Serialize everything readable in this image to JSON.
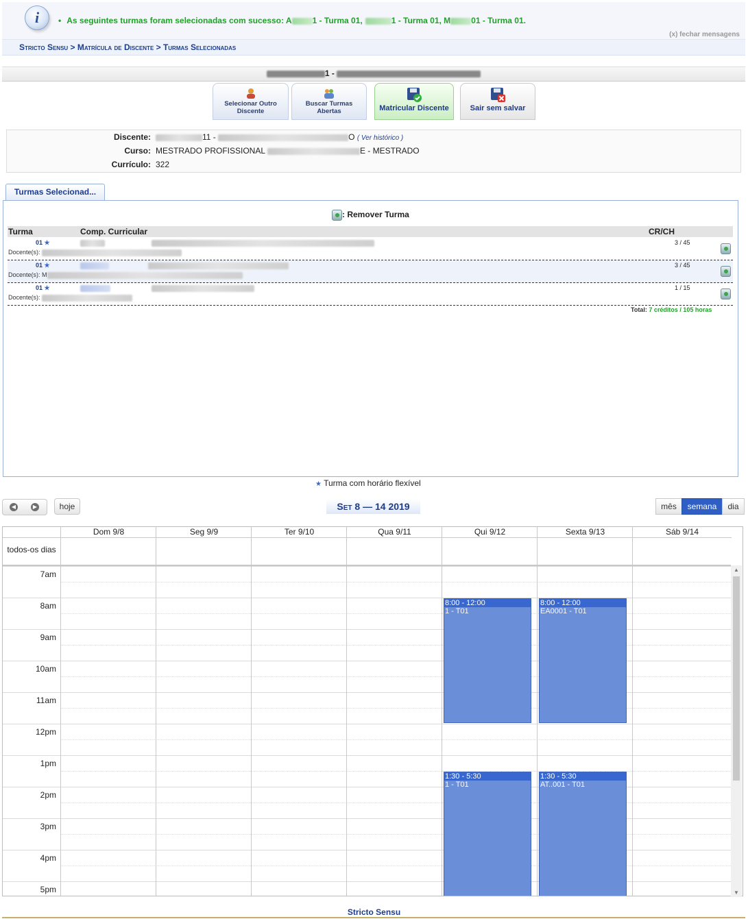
{
  "messages": {
    "success_prefix": "As seguintes turmas foram selecionadas com sucesso: A",
    "item1_suffix": "1 - Turma 01,",
    "item2_suffix": "1 - Turma 01, M",
    "item3_suffix": "01 - Turma 01.",
    "close_label": "(x) fechar mensagens"
  },
  "breadcrumb": "Stricto Sensu > Matrícula de Discente > Turmas Selecionadas",
  "student_header_suffix": "1 -",
  "actions": {
    "select_other": "Selecionar Outro Discente",
    "search_classes": "Buscar Turmas Abertas",
    "enroll": "Matricular Discente",
    "exit": "Sair sem salvar"
  },
  "info": {
    "discente_label": "Discente:",
    "discente_visible": "11 -",
    "discente_visible2": "O",
    "history_link": "( Ver histórico )",
    "curso_label": "Curso:",
    "curso_prefix": "MESTRADO PROFISSIONAL",
    "curso_suffix": "E - MESTRADO",
    "curriculo_label": "Currículo:",
    "curriculo_value": "322"
  },
  "tab_label": "Turmas Selecionad...",
  "remove_title": ": Remover Turma",
  "table": {
    "headers": [
      "Turma",
      "Comp. Curricular",
      "CR/CH"
    ],
    "rows": [
      {
        "turma": "01",
        "crch": "3 / 45",
        "doc_label": "Docente(s):"
      },
      {
        "turma": "01",
        "crch": "3 / 45",
        "doc_label": "Docente(s): M"
      },
      {
        "turma": "01",
        "crch": "1 / 15",
        "doc_label": "Docente(s):"
      }
    ],
    "total_label": "Total:",
    "total_value": "7 créditos / 105 horas"
  },
  "legend": "Turma com horário flexível",
  "calendar": {
    "today": "hoje",
    "title": "Set 8 — 14 2019",
    "views": [
      "mês",
      "semana",
      "dia"
    ],
    "allday_label": "todos-os dias",
    "days": [
      "Dom 9/8",
      "Seg 9/9",
      "Ter 9/10",
      "Qua 9/11",
      "Qui 9/12",
      "Sexta 9/13",
      "Sáb 9/14"
    ],
    "hours": [
      "7am",
      "8am",
      "9am",
      "10am",
      "11am",
      "12pm",
      "1pm",
      "2pm",
      "3pm",
      "4pm",
      "5pm"
    ],
    "events": [
      {
        "day": 4,
        "start": 8,
        "end": 12,
        "time": "8:00 - 12:00",
        "title": "1 - T01"
      },
      {
        "day": 5,
        "start": 8,
        "end": 12,
        "time": "8:00 - 12:00",
        "title": "EA0001 - T01"
      },
      {
        "day": 4,
        "start": 13.5,
        "end": 17.5,
        "time": "1:30 - 5:30",
        "title": "1 - T01"
      },
      {
        "day": 5,
        "start": 13.5,
        "end": 17.5,
        "time": "1:30 - 5:30",
        "title": "AT..001 - T01"
      }
    ]
  },
  "footer": "Stricto Sensu",
  "colors": {
    "accent": "#1c3c8c",
    "success": "#22a02a",
    "event": "#6b8ed9",
    "event_header": "#3868cf"
  }
}
